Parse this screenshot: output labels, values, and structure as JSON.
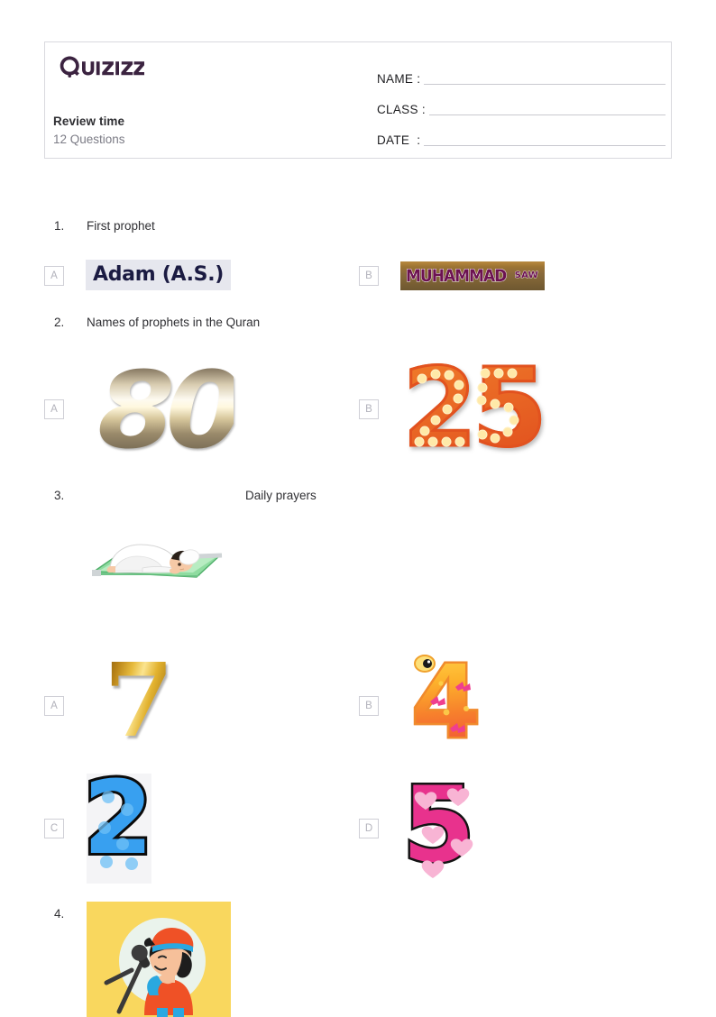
{
  "brand": {
    "name": "Quizizz",
    "logo_icon": "quizizz-logo",
    "color": "#3B2340"
  },
  "header": {
    "quiz_title": "Review time",
    "question_count": "12 Questions",
    "fields": [
      {
        "label": "NAME :",
        "value": ""
      },
      {
        "label": "CLASS :",
        "value": ""
      },
      {
        "label": "DATE  :",
        "value": ""
      }
    ]
  },
  "questions": [
    {
      "number": "1.",
      "text": "First prophet",
      "options": [
        {
          "letter": "A",
          "kind": "image",
          "alt": "Adam (A.S.)",
          "label": "Adam (A.S.)"
        },
        {
          "letter": "B",
          "kind": "image",
          "alt": "MUHAMMAD SAW banner",
          "label": "MUHAMMAD",
          "sublabel": "SAW"
        }
      ]
    },
    {
      "number": "2.",
      "text": "Names of prophets in the Quran",
      "options": [
        {
          "letter": "A",
          "kind": "image",
          "alt": "gold number 80",
          "label": "80"
        },
        {
          "letter": "B",
          "kind": "image",
          "alt": "marquee number 25",
          "label": "25"
        }
      ]
    },
    {
      "number": "3.",
      "text": "Daily prayers",
      "prompt_image": "muslim-praying-sujood-on-green-prayer-mat",
      "options": [
        {
          "letter": "A",
          "kind": "image",
          "alt": "gold number 7",
          "label": "7"
        },
        {
          "letter": "B",
          "kind": "image",
          "alt": "orange butterfly number 4",
          "label": "4"
        },
        {
          "letter": "C",
          "kind": "image",
          "alt": "blue polka dot number 2",
          "label": "2"
        },
        {
          "letter": "D",
          "kind": "image",
          "alt": "pink heart number 5",
          "label": "5"
        }
      ]
    },
    {
      "number": "4.",
      "text": "",
      "prompt_image": "child-singing-into-microphone-yellow-background",
      "options": []
    }
  ]
}
